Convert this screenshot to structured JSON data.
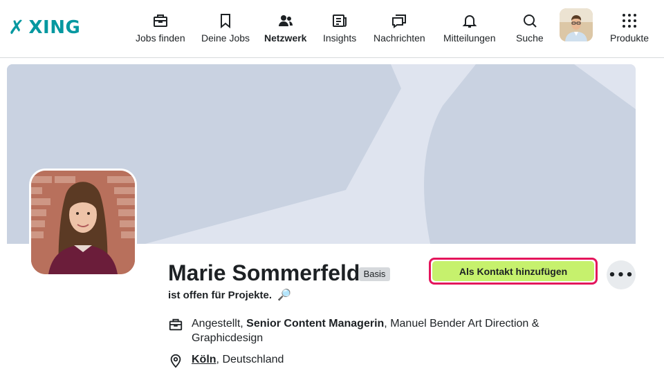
{
  "brand": {
    "name": "XING",
    "accent": "#0698a0",
    "accent2": "#b7df4b"
  },
  "nav": {
    "items": [
      {
        "label": "Jobs finden",
        "icon": "briefcase-icon",
        "active": false
      },
      {
        "label": "Deine Jobs",
        "icon": "bookmark-icon",
        "active": false
      },
      {
        "label": "Netzwerk",
        "icon": "people-icon",
        "active": true
      },
      {
        "label": "Insights",
        "icon": "news-icon",
        "active": false
      },
      {
        "label": "Nachrichten",
        "icon": "chat-icon",
        "active": false
      },
      {
        "label": "Mitteilungen",
        "icon": "bell-icon",
        "active": false
      },
      {
        "label": "Suche",
        "icon": "search-icon",
        "active": false
      },
      {
        "label": "Produkte",
        "icon": "grid-icon",
        "active": false
      }
    ]
  },
  "profile": {
    "name": "Marie Sommerfeld",
    "membership": "Basis",
    "status": "ist offen für Projekte.",
    "add_contact_label": "Als Kontakt hinzufügen",
    "more_label": "•••",
    "employment": {
      "type": "Angestellt,",
      "position": "Senior Content Managerin",
      "company": ", Manuel Bender Art Direction & Graphicdesign"
    },
    "location": {
      "city": "Köln",
      "country": ", Deutschland"
    }
  },
  "colors": {
    "cta": "#c6f16d",
    "highlight": "#e4155b",
    "cover": "#e1e5ee"
  }
}
